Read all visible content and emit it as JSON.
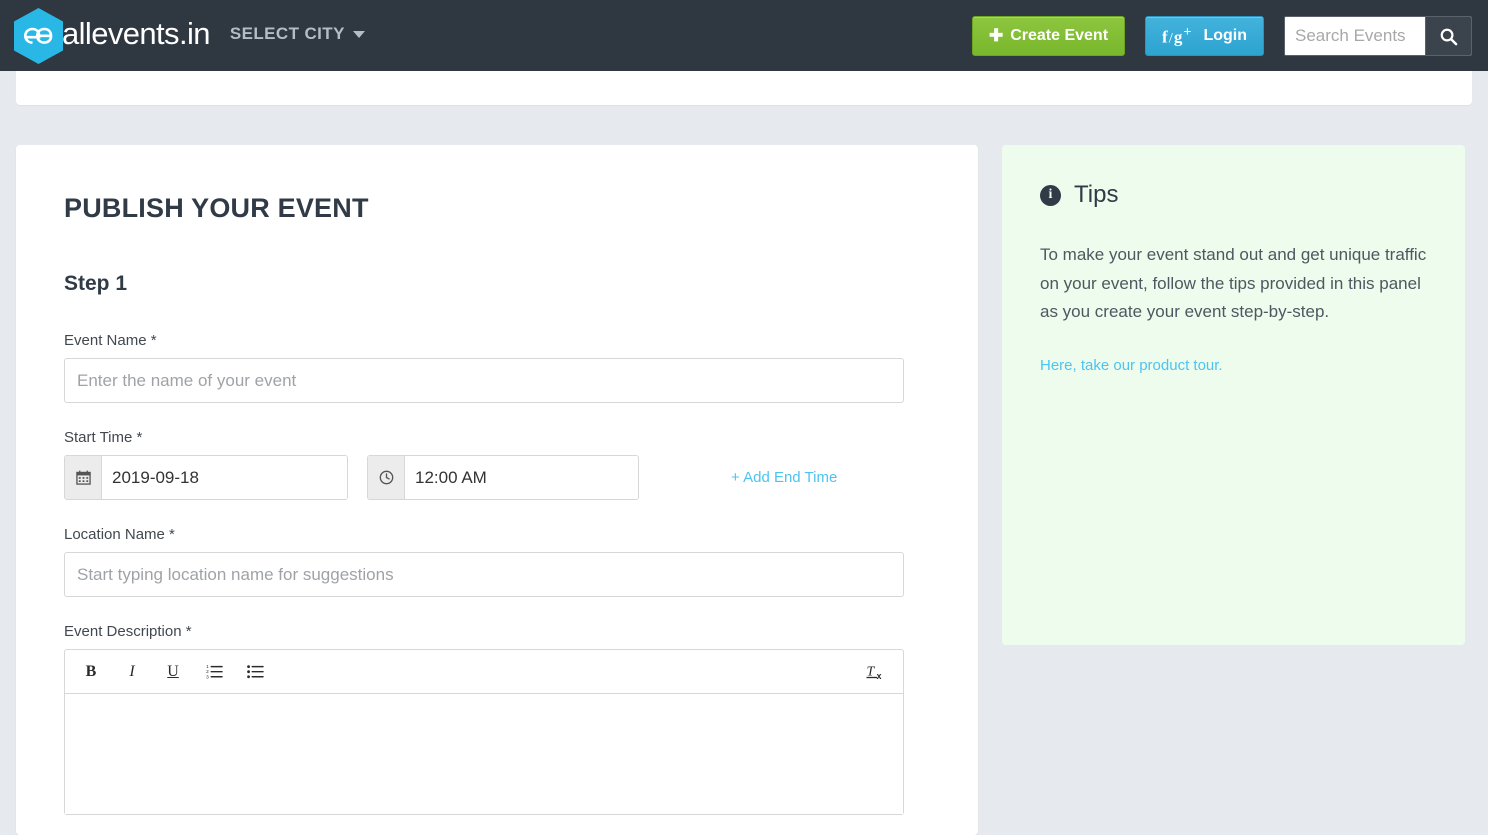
{
  "header": {
    "brand_name": "allevents.in",
    "logo_glyph": "æ",
    "select_city_label": "SELECT CITY",
    "create_event_label": "Create Event",
    "create_event_plus": "✚",
    "login_label": "Login",
    "login_social": "f",
    "login_slash": "/",
    "login_gplus": "g",
    "login_gplus_sup": "+",
    "search_placeholder": "Search Events",
    "search_value": "",
    "colors": {
      "header_bg": "#2f3741",
      "logo_cyan": "#29b8e5",
      "create_green": "#8dc63f",
      "login_blue": "#42b3dc",
      "page_bg": "#e6eaee",
      "link_blue": "#4dc4f0",
      "tips_bg": "#eefcee"
    }
  },
  "form": {
    "page_title": "PUBLISH YOUR EVENT",
    "step_title": "Step 1",
    "event_name": {
      "label": "Event Name *",
      "placeholder": "Enter the name of your event",
      "value": ""
    },
    "start_time": {
      "label": "Start Time *",
      "date_value": "2019-09-18",
      "time_value": "12:00 AM",
      "date_icon": "calendar-icon",
      "time_icon": "clock-icon",
      "add_end_time_label": "+ Add End Time"
    },
    "location_name": {
      "label": "Location Name *",
      "placeholder": "Start typing location name for suggestions",
      "value": ""
    },
    "event_description": {
      "label": "Event Description *",
      "value": "",
      "toolbar": {
        "bold": "B",
        "italic": "I",
        "underline": "U",
        "ordered_list": "ordered-list-icon",
        "unordered_list": "unordered-list-icon",
        "remove_format": "Tx"
      }
    }
  },
  "tips": {
    "icon": "info-icon",
    "title": "Tips",
    "body": "To make your event stand out and get unique traffic on your event, follow the tips provided in this panel as you create your event step-by-step.",
    "link_label": "Here, take our product tour."
  }
}
